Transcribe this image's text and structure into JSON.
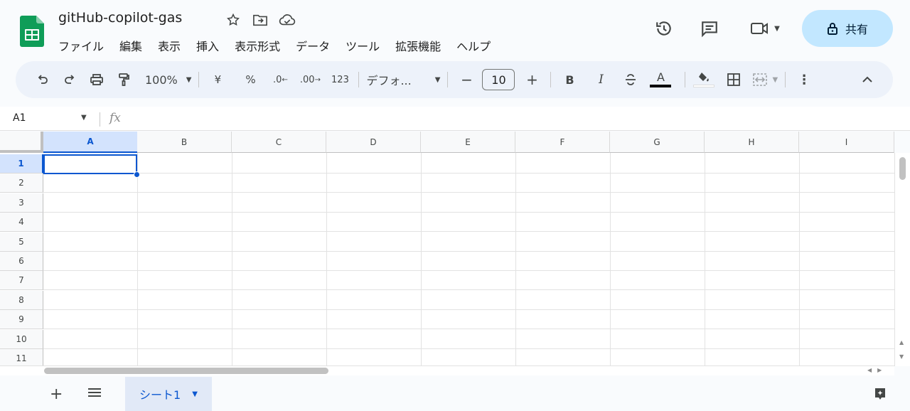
{
  "app": {
    "title": "gitHub-copilot-gas",
    "logo_icon": "google-sheets-logo",
    "title_icons": [
      "star-icon",
      "move-to-folder-icon",
      "cloud-saved-icon"
    ]
  },
  "menu": [
    "ファイル",
    "編集",
    "表示",
    "挿入",
    "表示形式",
    "データ",
    "ツール",
    "拡張機能",
    "ヘルプ"
  ],
  "header_actions": {
    "history_icon": "version-history-icon",
    "comments_icon": "comments-icon",
    "meet_icon": "video-call-icon",
    "share_label": "共有",
    "share_icon": "lock-icon"
  },
  "toolbar": {
    "zoom": "100%",
    "currency": "¥",
    "percent": "%",
    "dec_decrease": ".0",
    "dec_increase": ".00",
    "number_format": "123",
    "font": "デフォ...",
    "font_size": "10",
    "bold": "B",
    "italic": "I",
    "text_color_letter": "A",
    "text_color": "#000000",
    "fill_color": "#ffffff"
  },
  "formula_bar": {
    "name_box": "A1",
    "fx_label": "fx",
    "value": ""
  },
  "grid": {
    "columns": [
      "A",
      "B",
      "C",
      "D",
      "E",
      "F",
      "G",
      "H",
      "I"
    ],
    "rows": [
      "1",
      "2",
      "3",
      "4",
      "5",
      "6",
      "7",
      "8",
      "9",
      "10",
      "11"
    ],
    "selected_cell": "A1",
    "selection_color": "#0b57d0"
  },
  "sheets": {
    "tabs": [
      {
        "label": "シート1",
        "active": true
      }
    ],
    "add_icon": "plus-icon",
    "all_sheets_icon": "hamburger-icon",
    "explore_icon": "explore-icon"
  }
}
